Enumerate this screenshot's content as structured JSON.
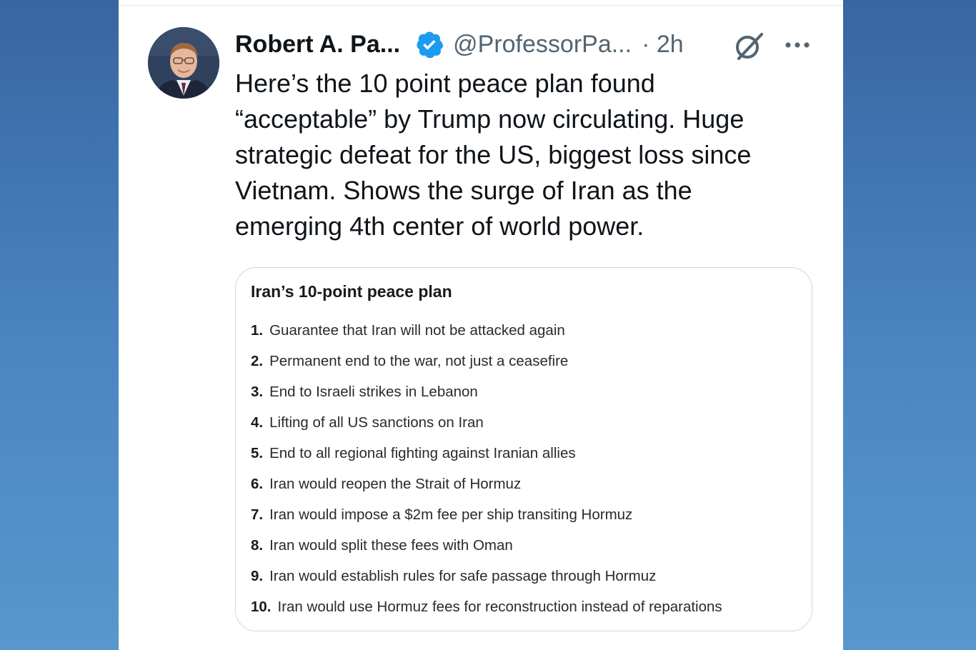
{
  "tweet": {
    "author_name": "Robert A. Pa...",
    "handle": "@ProfessorPa...",
    "time": "· 2h",
    "text_lines": [
      "Here’s the 10 point peace plan found",
      "“acceptable” by Trump now circulating.  Huge",
      "strategic defeat for the US, biggest loss since",
      "Vietnam.  Shows the surge of Iran as the",
      "emerging 4th center of world power."
    ],
    "icons": {
      "verified": "verified-badge-icon",
      "grok": "grok-icon",
      "more": "more-options-icon"
    },
    "colors": {
      "verified": "#1d9bf0",
      "secondary_text": "#536471",
      "primary_text": "#0f1419"
    }
  },
  "media": {
    "title": "Iran’s 10-point peace plan",
    "items": [
      {
        "num": "1.",
        "text": "Guarantee that Iran will not be attacked again"
      },
      {
        "num": "2.",
        "text": "Permanent end to the war, not just a ceasefire"
      },
      {
        "num": "3.",
        "text": "End to Israeli strikes in Lebanon"
      },
      {
        "num": "4.",
        "text": "Lifting of all US sanctions on Iran"
      },
      {
        "num": "5.",
        "text": "End to all regional fighting against Iranian allies"
      },
      {
        "num": "6.",
        "text": "Iran would reopen the Strait of Hormuz"
      },
      {
        "num": "7.",
        "text": "Iran would impose a $2m fee per ship transiting Hormuz"
      },
      {
        "num": "8.",
        "text": "Iran would split these fees with Oman"
      },
      {
        "num": "9.",
        "text": "Iran would establish rules for safe passage through Hormuz"
      },
      {
        "num": "10.",
        "text": "Iran would use Hormuz fees for reconstruction instead of reparations"
      }
    ]
  }
}
